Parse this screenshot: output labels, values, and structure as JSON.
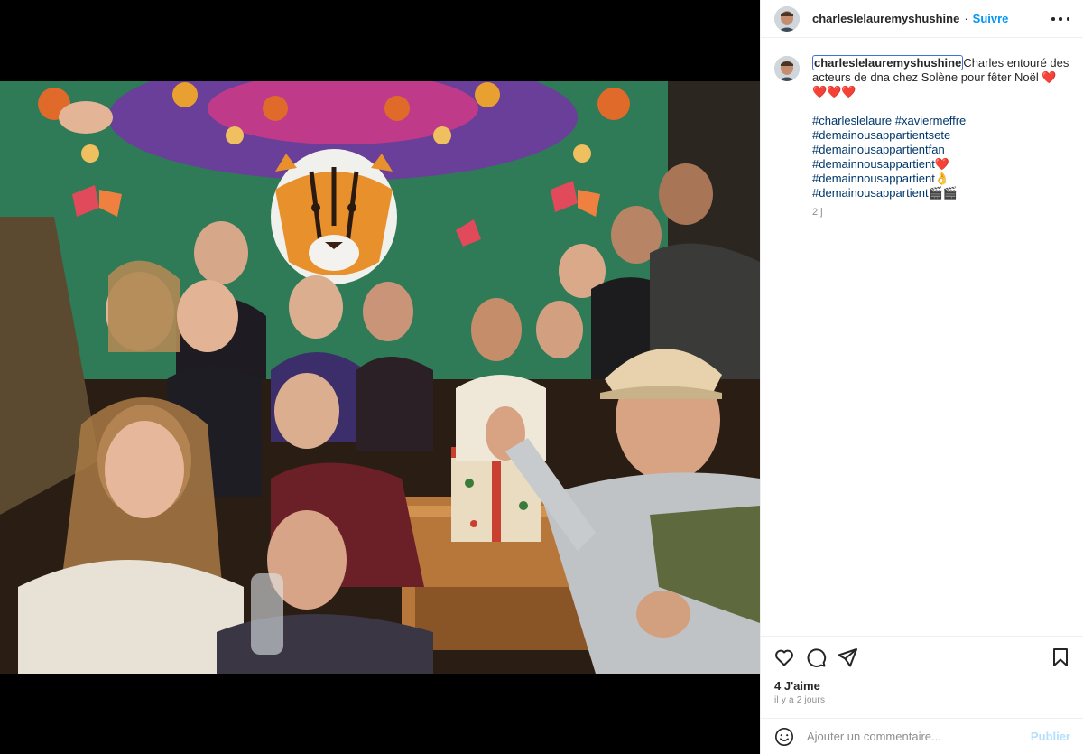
{
  "post": {
    "username": "charleslelauremyshushine",
    "follow_label": "Suivre",
    "separator": "·",
    "caption": {
      "username": "charleslelauremyshushine",
      "text": "Charles entouré des acteurs de dna chez Solène pour fêter Noël ",
      "hearts": "❤️❤️❤️❤️"
    },
    "hashtags": [
      {
        "text": "#charleslelaure #xaviermeffre",
        "emoji": ""
      },
      {
        "text": "#demainousappartientsete",
        "emoji": ""
      },
      {
        "text": "#demainousappartientfan",
        "emoji": ""
      },
      {
        "text": "#demainnousappartient",
        "emoji": "❤️"
      },
      {
        "text": "#demainnousappartient",
        "emoji": "👌"
      },
      {
        "text": "#demainousappartient",
        "emoji": "🎬🎬"
      }
    ],
    "caption_time": "2 j",
    "likes": "4 J'aime",
    "date": "il y a 2 jours",
    "comment_placeholder": "Ajouter un commentaire...",
    "post_label": "Publier"
  },
  "icons": {
    "more": "more-options-icon",
    "like": "heart-icon",
    "comment": "comment-bubble-icon",
    "share": "paper-plane-icon",
    "save": "bookmark-icon",
    "emoji": "emoji-smiley-icon"
  },
  "colors": {
    "link": "#00376b",
    "follow": "#0095f6",
    "publish_disabled": "#b2dffc",
    "secondary_text": "#8e8e8e"
  }
}
